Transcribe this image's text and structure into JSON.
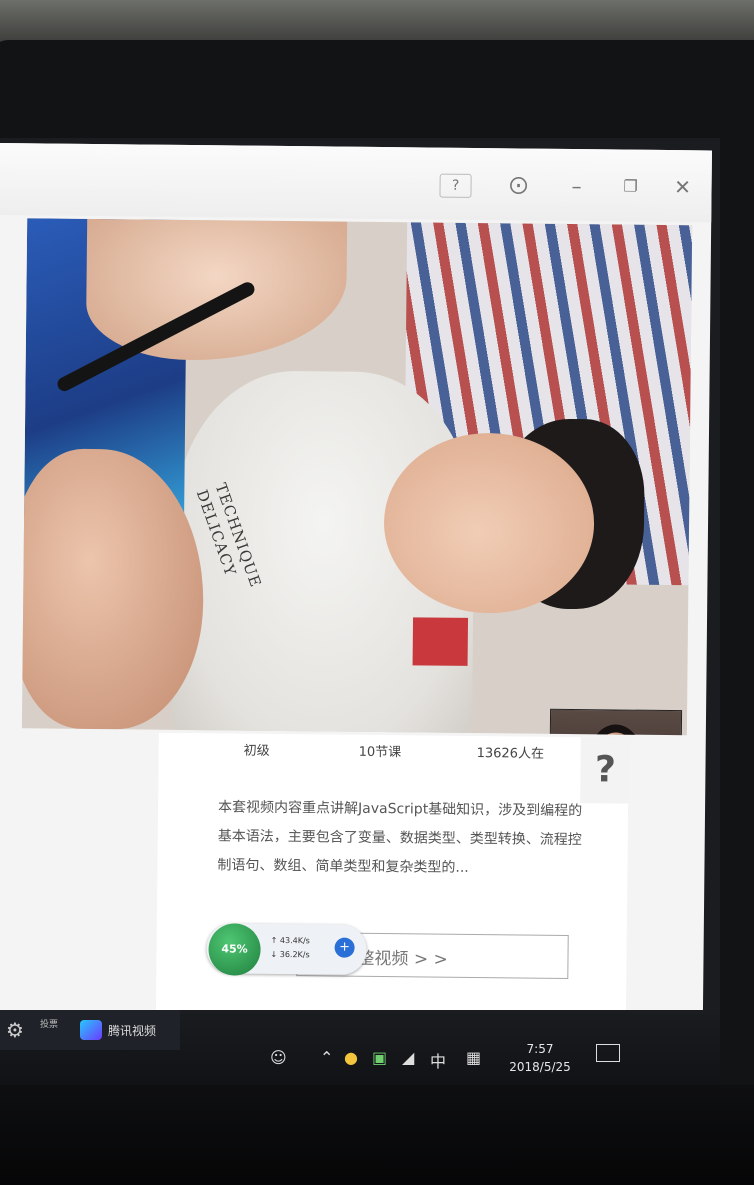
{
  "window": {
    "help_label": "?",
    "skin_icon": "shirt-icon",
    "minimize_icon": "minimize-icon",
    "restore_icon": "restore-icon",
    "close_icon": "close-icon"
  },
  "video": {
    "shirt_text_line1": "TECHNIQUE",
    "shirt_text_line2": "DELICACY"
  },
  "course": {
    "level": "初级",
    "lessons": "10节课",
    "learners": "13626人在",
    "help_mark": "?",
    "description": "本套视频内容重点讲解JavaScript基础知识，涉及到编程的基本语法，主要包含了变量、数据类型、类型转换、流程控制语句、数组、简单类型和复杂类型的...",
    "full_video_button": "整视频 > >"
  },
  "speed_widget": {
    "percent": "45%",
    "up_rate": "43.4K/s",
    "down_rate": "36.2K/s",
    "plus": "+"
  },
  "taskbar": {
    "left_tile_text": "投票",
    "player_label": "腾讯视频",
    "ime_label": "中",
    "time": "7:57",
    "date": "2018/5/25"
  },
  "colors": {
    "desktop_bg": "#0a0a0c",
    "window_bg": "#f4f4f4",
    "speed_green": "#2fa357",
    "speed_plus_blue": "#2a6fd8"
  }
}
